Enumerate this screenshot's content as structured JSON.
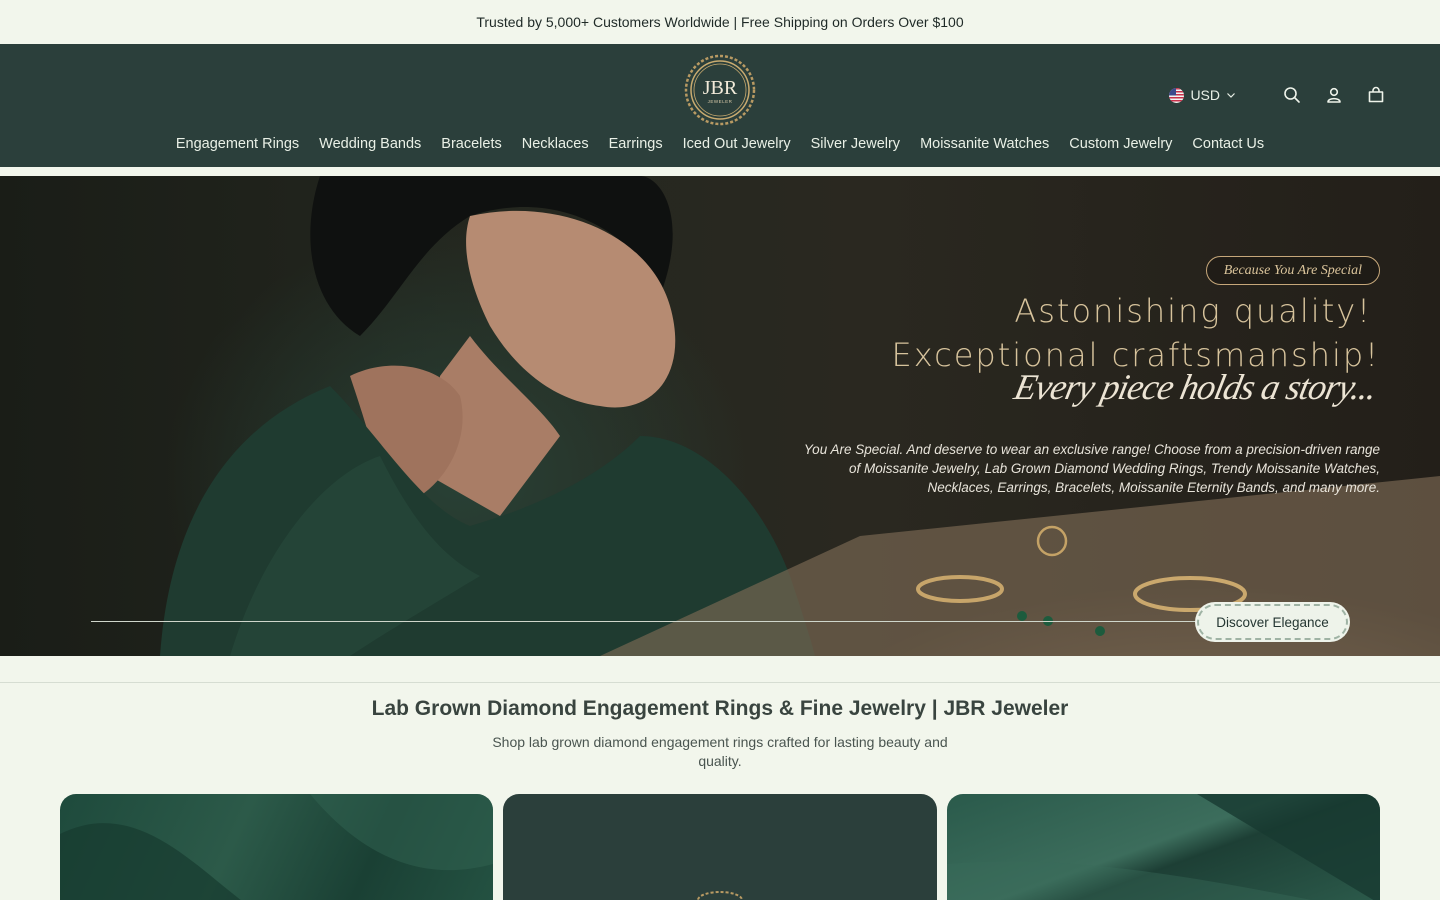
{
  "announcement": "Trusted by 5,000+ Customers Worldwide | Free Shipping on Orders Over $100",
  "header": {
    "logo_text": "JBR",
    "logo_subtext": "JEWELER",
    "currency": "USD",
    "icons": [
      "search-icon",
      "account-icon",
      "cart-icon"
    ]
  },
  "nav": [
    "Engagement Rings",
    "Wedding Bands",
    "Bracelets",
    "Necklaces",
    "Earrings",
    "Iced Out Jewelry",
    "Silver Jewelry",
    "Moissanite Watches",
    "Custom Jewelry",
    "Contact Us"
  ],
  "hero": {
    "tagline": "Because You Are Special",
    "headline_line1": "Astonishing quality!",
    "headline_line2": "Exceptional craftsmanship!",
    "script": "Every piece holds a story...",
    "description": "You Are Special. And deserve to wear an exclusive range! Choose from a precision-driven range of Moissanite Jewelry, Lab Grown Diamond Wedding Rings, Trendy Moissanite Watches, Necklaces, Earrings, Bracelets, Moissanite Eternity Bands, and many more.",
    "cta": "Discover Elegance"
  },
  "section": {
    "title": "Lab Grown Diamond Engagement Rings & Fine Jewelry | JBR Jeweler",
    "subtitle": "Shop lab grown diamond engagement rings crafted for lasting beauty and quality."
  },
  "colors": {
    "header_bg": "#2b3f3b",
    "page_bg": "#f2f6ec",
    "gold": "#c6a77a"
  }
}
